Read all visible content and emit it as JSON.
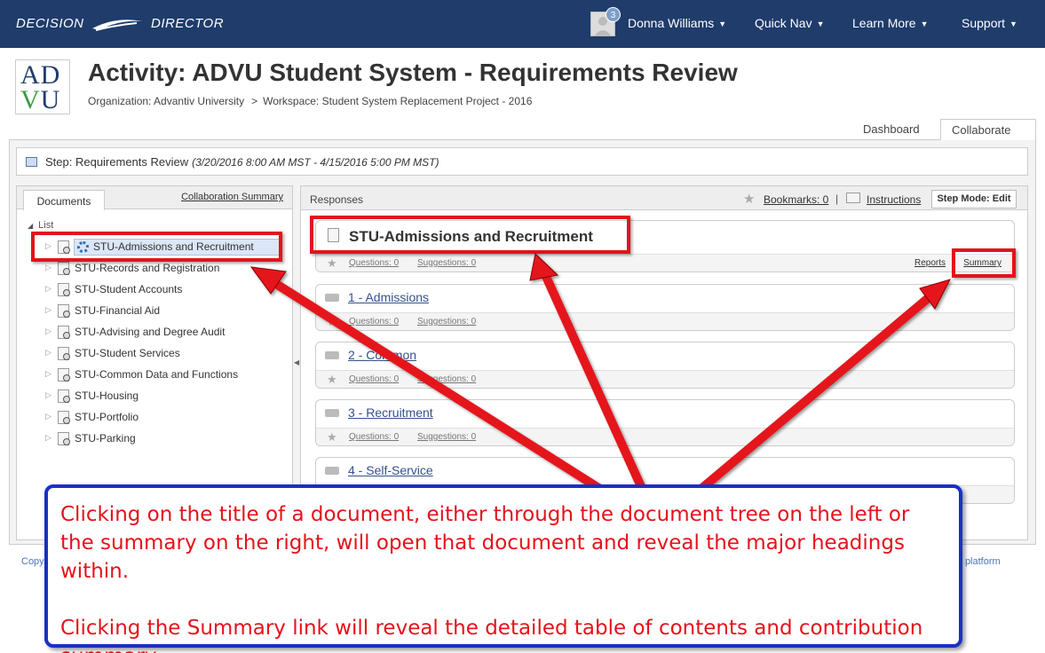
{
  "nav": {
    "brand_left": "DECISION",
    "brand_right": "DIRECTOR",
    "notification_count": "3",
    "user_name": "Donna Williams",
    "quick_nav": "Quick Nav",
    "learn_more": "Learn More",
    "support": "Support"
  },
  "header": {
    "logo_line1_a": "AD",
    "logo_line2_a": "V",
    "logo_line2_b": "U",
    "title": "Activity: ADVU Student System - Requirements Review",
    "org": "Organization: Advantiv University",
    "crumb_sep": ">",
    "workspace": "Workspace: Student System Replacement Project - 2016"
  },
  "tabs": {
    "dashboard": "Dashboard",
    "collaborate": "Collaborate"
  },
  "step": {
    "label": "Step: Requirements Review",
    "dates": "(3/20/2016 8:00 AM MST - 4/15/2016 5:00 PM MST)"
  },
  "documents": {
    "tab_label": "Documents",
    "collab_summary": "Collaboration Summary",
    "root": "List",
    "items": [
      "STU-Admissions and Recruitment",
      "STU-Records and Registration",
      "STU-Student Accounts",
      "STU-Financial Aid",
      "STU-Advising and Degree Audit",
      "STU-Student Services",
      "STU-Common Data and Functions",
      "STU-Housing",
      "STU-Portfolio",
      "STU-Parking"
    ]
  },
  "responses": {
    "header": "Responses",
    "bookmarks": "Bookmarks: 0",
    "pipe": "|",
    "instructions": "Instructions",
    "step_mode": "Step Mode: Edit",
    "main_title": "STU-Admissions and Recruitment",
    "reports": "Reports",
    "summary": "Summary",
    "questions": "Questions: 0",
    "suggestions": "Suggestions: 0",
    "sections": [
      "1 - Admissions",
      "2 - Common",
      "3 - Recruitment",
      "4 - Self-Service"
    ]
  },
  "footer": {
    "left": "Copy",
    "right": "or® platform"
  },
  "callout": {
    "para1": "Clicking on the title of a document, either through the document tree on the left or the summary on the right, will open that document and reveal the major headings within.",
    "para2": "Clicking the Summary link will reveal the detailed table of contents and contribution summary."
  },
  "colors": {
    "nav_bg": "#1f3c6b",
    "annotation_red": "#e4121b",
    "callout_border": "#1a2fc8"
  }
}
